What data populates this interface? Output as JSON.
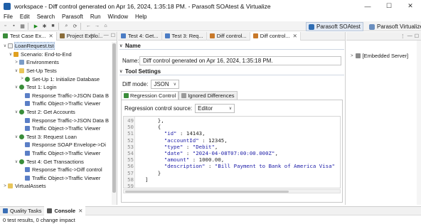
{
  "window": {
    "title": "workspace - Diff control generated on Apr 16, 2024, 1:35:18 PM. - Parasoft SOAtest & Virtualize",
    "controls": [
      "—",
      "☐",
      "✕"
    ]
  },
  "menu": [
    "File",
    "Edit",
    "Search",
    "Parasoft",
    "Run",
    "Window",
    "Help"
  ],
  "toolbar": {
    "icons": [
      "new-icon",
      "save-icon",
      "print-icon",
      "run-icon",
      "debug-icon",
      "stop-icon",
      "search-icon",
      "refresh-icon",
      "back-icon",
      "forward-icon",
      "home-icon"
    ],
    "glyphs": [
      "▫",
      "▪",
      "▦",
      "▶",
      "✱",
      "■",
      "⌕",
      "⟳",
      "←",
      "→",
      "⌂"
    ],
    "perspectives": [
      {
        "label": "Parasoft SOAtest",
        "active": true,
        "color": "#2f6db3"
      },
      {
        "label": "Parasoft Virtualize",
        "active": false,
        "color": "#333333"
      }
    ]
  },
  "left_panel": {
    "tabs": [
      {
        "label": "Test Case Ex...",
        "close": "✕",
        "active": true
      },
      {
        "label": "Project Explo...",
        "close": "",
        "active": false
      }
    ],
    "tool_glyphs": [
      "⇆",
      "⋮",
      "—",
      "☐"
    ],
    "tree": [
      {
        "label": "LoanRequest.tst",
        "depth": 0,
        "twisty": "∨",
        "icon": "file",
        "selected": true
      },
      {
        "label": "Scenario: End-to-End",
        "depth": 1,
        "twisty": "∨",
        "icon": "scenario"
      },
      {
        "label": "Environments",
        "depth": 2,
        "twisty": ">",
        "icon": "env"
      },
      {
        "label": "Set-Up Tests",
        "depth": 2,
        "twisty": "∨",
        "icon": "folder"
      },
      {
        "label": "Set-Up 1: Initialize Database",
        "depth": 3,
        "twisty": ">",
        "icon": "test"
      },
      {
        "label": "Test 1: Login",
        "depth": 2,
        "twisty": "∨",
        "icon": "test"
      },
      {
        "label": "Response Traffic->JSON Data B",
        "depth": 3,
        "twisty": "",
        "icon": "tool"
      },
      {
        "label": "Traffic Object->Traffic Viewer",
        "depth": 3,
        "twisty": "",
        "icon": "tool"
      },
      {
        "label": "Test 2: Get Accounts",
        "depth": 2,
        "twisty": "∨",
        "icon": "test"
      },
      {
        "label": "Response Traffic->JSON Data B",
        "depth": 3,
        "twisty": "",
        "icon": "tool"
      },
      {
        "label": "Traffic Object->Traffic Viewer",
        "depth": 3,
        "twisty": "",
        "icon": "tool"
      },
      {
        "label": "Test 3: Request Loan",
        "depth": 2,
        "twisty": "∨",
        "icon": "test"
      },
      {
        "label": "Response SOAP Envelope->Di",
        "depth": 3,
        "twisty": "",
        "icon": "tool"
      },
      {
        "label": "Traffic Object->Traffic Viewer",
        "depth": 3,
        "twisty": "",
        "icon": "tool"
      },
      {
        "label": "Test 4: Get Transactions",
        "depth": 2,
        "twisty": "∨",
        "icon": "test"
      },
      {
        "label": "Response Traffic->Diff control",
        "depth": 3,
        "twisty": "",
        "icon": "tool"
      },
      {
        "label": "Traffic Object->Traffic Viewer",
        "depth": 3,
        "twisty": "",
        "icon": "tool"
      },
      {
        "label": "VirtualAssets",
        "depth": 0,
        "twisty": ">",
        "icon": "folder"
      }
    ]
  },
  "editor": {
    "tabs": [
      {
        "label": "Test 4: Get...",
        "active": false
      },
      {
        "label": "Test 3: Req...",
        "active": false
      },
      {
        "label": "Diff control...",
        "active": false
      },
      {
        "label": "Diff control...",
        "active": true
      }
    ],
    "close": "✕",
    "name_section": {
      "heading": "Name",
      "twisty": "∨",
      "label": "Name:",
      "value": "Diff control generated on Apr 16, 2024, 1:35:18 PM."
    },
    "tool_settings": {
      "heading": "Tool Settings",
      "twisty": "∨",
      "diff_mode_label": "Diff mode:",
      "diff_mode_value": "JSON",
      "chevron": "∨"
    },
    "rc_tabs": [
      {
        "label": "Regression Control",
        "active": true
      },
      {
        "label": "Ignored Differences",
        "active": false
      }
    ],
    "regression_source": {
      "label": "Regression control source:",
      "value": "Editor",
      "chevron": "∨"
    },
    "code_lines": [
      {
        "n": "49",
        "parts": [
          {
            "t": "    },",
            "c": "plain"
          }
        ]
      },
      {
        "n": "50",
        "parts": [
          {
            "t": "    {",
            "c": "plain"
          }
        ]
      },
      {
        "n": "51",
        "parts": [
          {
            "t": "      ",
            "c": "plain"
          },
          {
            "t": "\"id\"",
            "c": "key"
          },
          {
            "t": " : 14143,",
            "c": "plain"
          }
        ]
      },
      {
        "n": "52",
        "parts": [
          {
            "t": "      ",
            "c": "plain"
          },
          {
            "t": "\"accountId\"",
            "c": "key"
          },
          {
            "t": " : 12345,",
            "c": "plain"
          }
        ]
      },
      {
        "n": "53",
        "parts": [
          {
            "t": "      ",
            "c": "plain"
          },
          {
            "t": "\"type\"",
            "c": "key"
          },
          {
            "t": " : ",
            "c": "plain"
          },
          {
            "t": "\"Debit\"",
            "c": "str"
          },
          {
            "t": ",",
            "c": "plain"
          }
        ]
      },
      {
        "n": "54",
        "parts": [
          {
            "t": "      ",
            "c": "plain"
          },
          {
            "t": "\"date\"",
            "c": "key"
          },
          {
            "t": " : ",
            "c": "plain"
          },
          {
            "t": "\"2024-04-08T07:00:00.000Z\"",
            "c": "str"
          },
          {
            "t": ",",
            "c": "plain"
          }
        ]
      },
      {
        "n": "55",
        "parts": [
          {
            "t": "      ",
            "c": "plain"
          },
          {
            "t": "\"amount\"",
            "c": "key"
          },
          {
            "t": " : 1000.00,",
            "c": "plain"
          }
        ]
      },
      {
        "n": "56",
        "parts": [
          {
            "t": "      ",
            "c": "plain"
          },
          {
            "t": "\"description\"",
            "c": "key"
          },
          {
            "t": " : ",
            "c": "plain"
          },
          {
            "t": "\"Bill Payment to Bank of America Visa\"",
            "c": "str"
          }
        ]
      },
      {
        "n": "57",
        "parts": [
          {
            "t": "    }",
            "c": "plain"
          }
        ]
      },
      {
        "n": "58",
        "parts": [
          {
            "t": "]",
            "c": "plain"
          }
        ]
      },
      {
        "n": "59",
        "parts": [
          {
            "t": "",
            "c": "plain"
          }
        ]
      }
    ]
  },
  "right_panel": {
    "tool_glyphs": [
      "⋮",
      "—",
      "☐"
    ],
    "server": {
      "label": "[Embedded Server]",
      "twisty": ">"
    }
  },
  "bottom": {
    "tabs": [
      {
        "label": "Quality Tasks",
        "active": false,
        "close": ""
      },
      {
        "label": "Console",
        "active": true,
        "close": "✕"
      }
    ],
    "status": "0 test results, 0 change impact"
  },
  "colors": {
    "accent": "#2f6db3",
    "key": "#1e1ea8",
    "selection": "#d8e6f7"
  }
}
